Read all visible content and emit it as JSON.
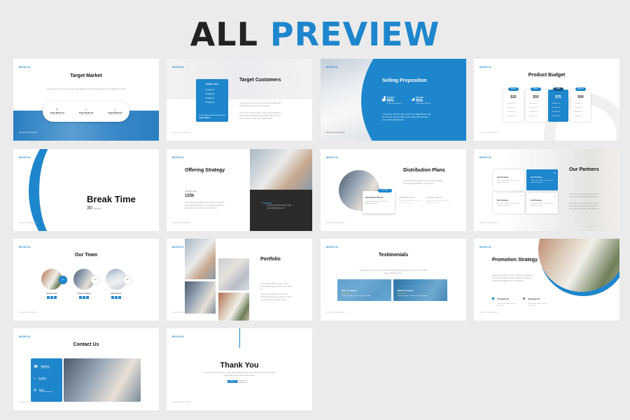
{
  "header": {
    "word1": "ALL",
    "word2": "PREVIEW"
  },
  "colors": {
    "accent": "#1e86cc",
    "dark": "#222222",
    "background": "#ebebeb"
  },
  "common": {
    "brand": "MUNICA",
    "footer": "Report Presentation"
  },
  "slides": [
    {
      "title": "Target Market",
      "body": "Lorem ipsum dolor sit amet, conse ctetur adipiscing elit, sed do eiusmod tempor incididunt ut labore",
      "items": [
        {
          "icon": "location-pin-icon",
          "label": "Target Market 01",
          "text": "Lorem ipsum dolor"
        },
        {
          "icon": "chat-icon",
          "label": "Target Market 02",
          "text": "Lorem ipsum dolor"
        },
        {
          "icon": "clipboard-icon",
          "label": "Target Market 03",
          "text": "Lorem ipsum dolor"
        }
      ]
    },
    {
      "title": "Target Customers",
      "card_title": "Subtitle Here",
      "checks": [
        "Target 01",
        "Target 02",
        "Target 03",
        "Target 04"
      ],
      "cta": "Learn More →",
      "body1": "Lorem ipsum dolor sit amet, conse ctetur adipiscing elit, sed do eius dolor sit ipsum ipsum",
      "body2": "Lorem ipsum dolor sit amet, conse ctetur adipiscing elit, sed do eius dolor sit amet ipsum dolore ipsum dolor sit amet, conse ctetur adipiscing elit"
    },
    {
      "title": "Selling Proposition",
      "stats": [
        {
          "icon": "bar-growth-icon",
          "label": "Text Here",
          "value": "65%",
          "text": "Lorem ipsum dolor sit"
        },
        {
          "icon": "bar-rising-icon",
          "label": "Text Here",
          "value": "65%",
          "text": "Lorem ipsum dolor sit"
        }
      ],
      "body": "Lorem ipsum dolor sit amet, conse ctetur adipiscing elit, sed do eius dolor sit ipsum dolore ipsum ipsum dolor sit amet, conse ctetur adipiscing elit."
    },
    {
      "title": "Product Budget",
      "plans": [
        {
          "name": "Bronze",
          "price": "$25",
          "highlight": false,
          "features": [
            "Features 01",
            "Features 02",
            "Features 03",
            "Features 04"
          ]
        },
        {
          "name": "Silver",
          "price": "$50",
          "highlight": false,
          "features": [
            "Features 01",
            "Features 02",
            "Features 03",
            "Features 04"
          ]
        },
        {
          "name": "Gold",
          "price": "$75",
          "highlight": true,
          "features": [
            "Features 01",
            "Features 02",
            "Features 03",
            "Features 04"
          ]
        },
        {
          "name": "Platinum",
          "price": "$99",
          "highlight": false,
          "features": [
            "Features 01",
            "Features 02",
            "Features 03",
            "Features 04"
          ]
        }
      ]
    },
    {
      "title": "Break Time",
      "number": "30",
      "unit": "Minutes"
    },
    {
      "title": "Offering Strategy",
      "subtitle": "Subtitle Here",
      "value": "123k",
      "body": "Lorem Ipsum is simply dummy text of the printing and typesetting industry. Lorem Ipsum has been the industry's standard dummy text ever.",
      "panel_title": "Strategy",
      "panel_text": "Lorem ipsum dolor sit amet, conse ctetur adipiscing elit, sed"
    },
    {
      "title": "Distribution Plans",
      "body": "Lorem Ipsum is simply dummy text of the printing and typesetting industry. Lorem Ipsum.",
      "badge": "Text Here",
      "plans": [
        {
          "label": "Distribution Plan 01",
          "text": "Lorem ipsum dolor sit amet, lacus nullacat consectur."
        },
        {
          "label": "Distribution Plan 02",
          "text": "Lorem ipsum dolor sit amet, lacus nullacat consectur."
        },
        {
          "label": "Distribution Plan 03",
          "text": "Lorem ipsum dolor sit amet, lacus nullacat consectur."
        }
      ]
    },
    {
      "title": "Our Partners",
      "cards": [
        {
          "num": "01",
          "label": "Our Partners",
          "text": "Lorem ipsum dolor sit amet, lacus nullacat consectur."
        },
        {
          "num": "02",
          "label": "Our Partners",
          "text": "Lorem ipsum dolor sit amet, lacus nullacat consectur."
        },
        {
          "num": "03",
          "label": "Our Partners",
          "text": "Lorem ipsum dolor sit amet, lacus nullacat consectur."
        },
        {
          "num": "04",
          "label": "Our Partners",
          "text": "Lorem ipsum dolor sit amet, lacus nullacat consectur."
        }
      ],
      "body1": "Lorem Ipsum is simply dummy text of the printing and typesetting industry.",
      "body2": "Lorem Ipsum is simply dummy text of the printing and typesetting industry. Lorem Ipsum has been the industry's"
    },
    {
      "title": "Our Team",
      "members": [
        {
          "name": "Jessica Jane",
          "role": "CEO"
        },
        {
          "name": "Cristian Mathew",
          "role": "CEO"
        },
        {
          "name": "Maria Dayes",
          "role": "CEO"
        }
      ]
    },
    {
      "title": "Portfolio",
      "body1": "Lorem ipsum dolor sit amet, conse ctetur adipiscing elit, sed do eius, dolor sit",
      "body2": "Lorem ipsum dolor sit amet, conse ctetur adipiscing elit, sed do eius, dolor sit Lorem ipsum dolorsum ipsum"
    },
    {
      "title": "Testimonials",
      "body": "Lorem ipsum dolor sit amet, conse ctetur adipiscing elit, sed do eius, dolor sit Lorem ipsum dolorsum ipsum",
      "cards": [
        {
          "company": "Mark Company",
          "rating": 5,
          "text": "Lorem ipsum dolor sit amet, conse ctetur adipis"
        },
        {
          "company": "Nikita Company",
          "rating": 5,
          "text": "Lorem ipsum dolor sit amet, conse ctetur adipis"
        }
      ]
    },
    {
      "title": "Promotion Strategy",
      "body": "Lorem ipsum dolor sit amet, consectetur adipiscing elit, sed do eiusmod tempor incididunt ut labore et dolore magna aliqua amet, consectetur",
      "strategies": [
        {
          "label": "Strategies 01",
          "text": "Lorem ipsum dolor sit amet, lacus nulla"
        },
        {
          "label": "Strategies 02",
          "text": "Lorem ipsum dolor sit amet, lacus nulla"
        }
      ]
    },
    {
      "title": "Contact Us",
      "contacts": [
        {
          "icon": "phone-icon",
          "label": "Telephone",
          "value": "010-800-000"
        },
        {
          "icon": "location-icon",
          "label": "Location",
          "value": "London, UK"
        },
        {
          "icon": "email-icon",
          "label": "Email",
          "value": "Hello@Munica.com"
        }
      ]
    },
    {
      "title": "Thank You",
      "body": "Lorem ipsum dolor sit amet, conse ctetur adipiscing elit, sed do eius, dolor sit amet Lorem ipsum dolor Lorem ipsum Lorem ipsum",
      "button_primary": "Website",
      "button_secondary": "Contact"
    }
  ]
}
